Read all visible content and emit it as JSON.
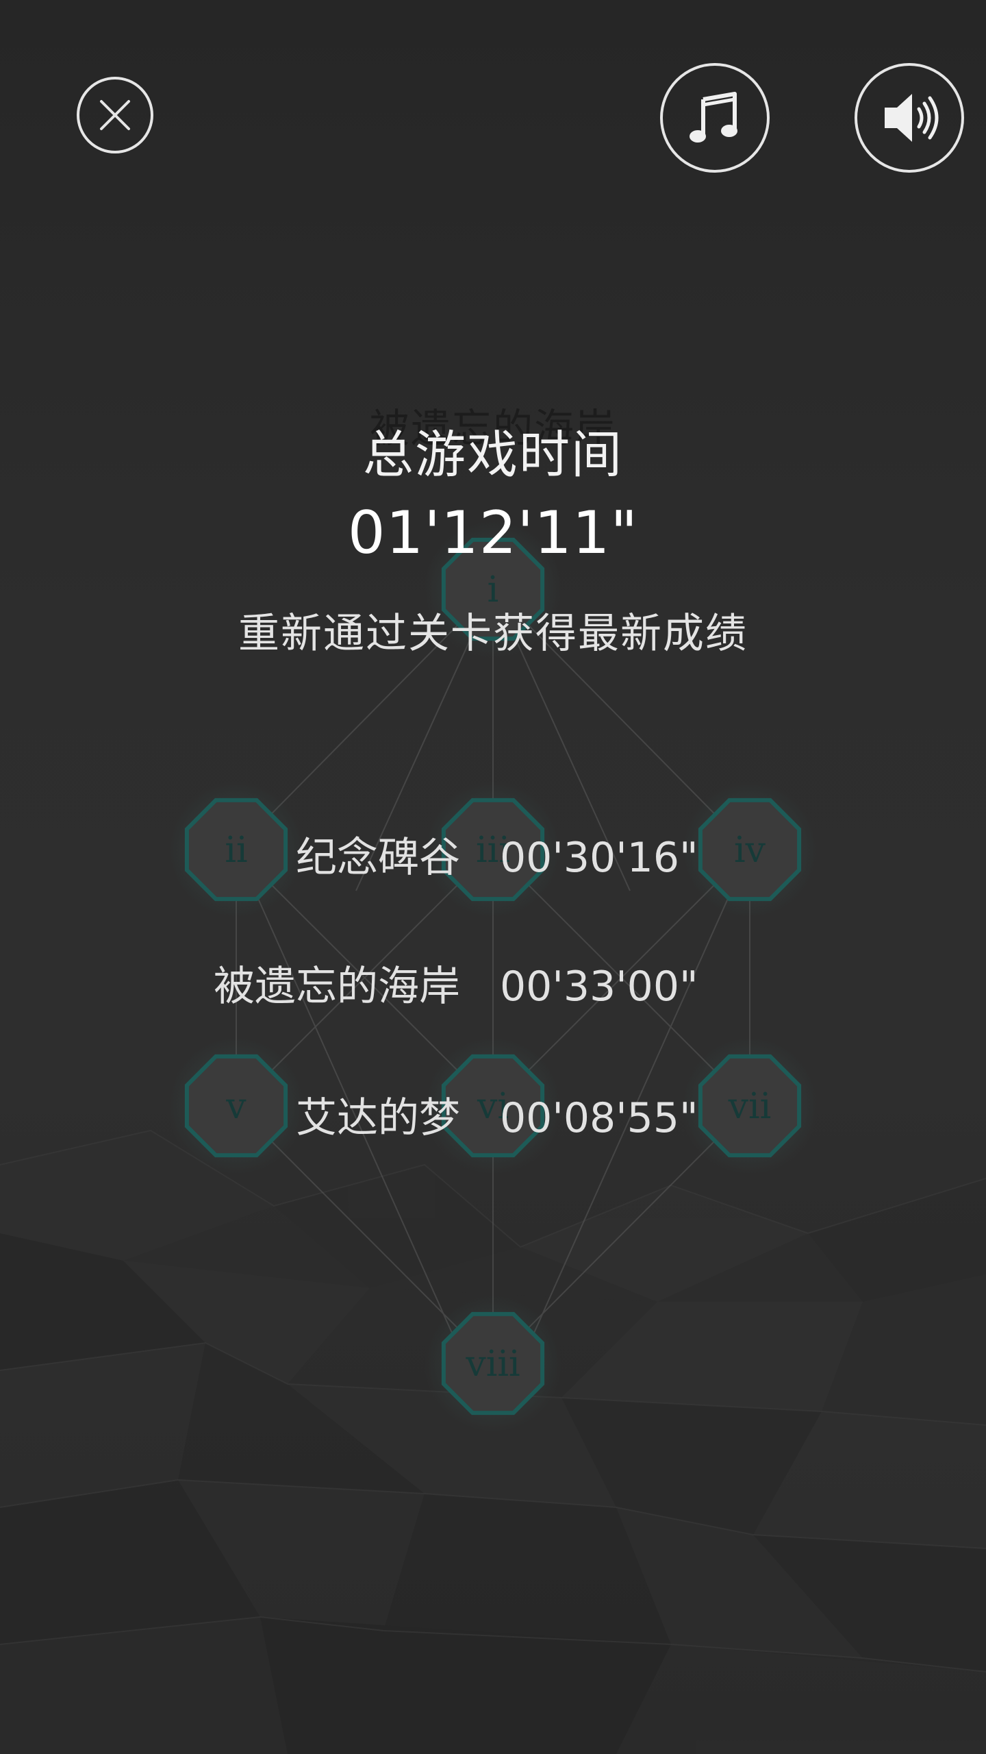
{
  "controls": {
    "close_icon": "close-icon",
    "music_icon": "music-note-icon",
    "sound_icon": "speaker-icon"
  },
  "level_map": {
    "current_level_name": "被遗忘的海岸",
    "nodes": [
      "i",
      "ii",
      "iii",
      "iv",
      "v",
      "vi",
      "vii",
      "viii"
    ],
    "accent_color": "#1d5b57"
  },
  "summary": {
    "title": "总游戏时间",
    "total_time": "01'12'11\"",
    "subtitle": "重新通过关卡获得最新成绩"
  },
  "records": [
    {
      "name": "纪念碑谷",
      "time": "00'30'16\""
    },
    {
      "name": "被遗忘的海岸",
      "time": "00'33'00\""
    },
    {
      "name": "艾达的梦",
      "time": "00'08'55\""
    }
  ]
}
